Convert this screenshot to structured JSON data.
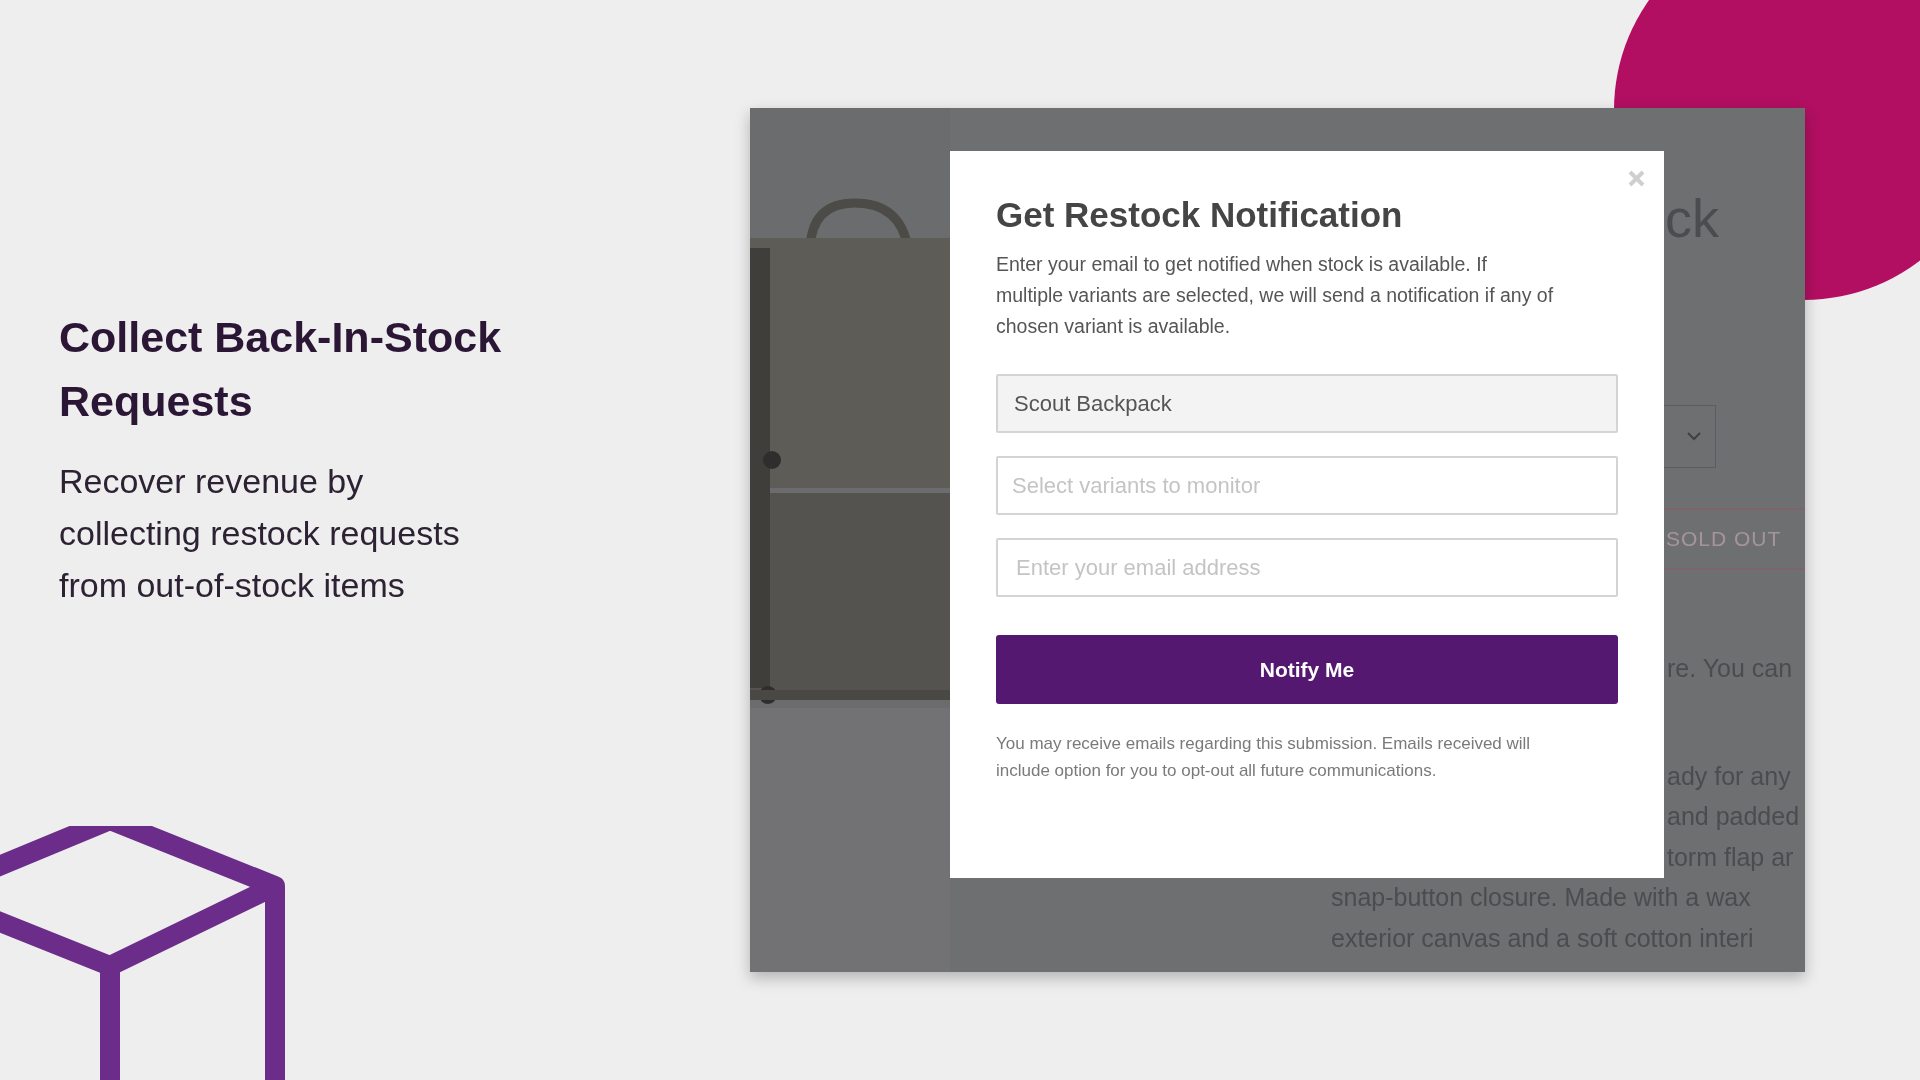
{
  "intro": {
    "heading": "Collect Back-In-Stock Requests",
    "description": "Recover revenue by collecting restock requests from out-of-stock items"
  },
  "store_page": {
    "title_fragment": "ck",
    "sold_out": "SOLD OUT",
    "description_lines": [
      {
        "text": "re. You can",
        "partial": true
      },
      {
        "text": "ady for any",
        "partial": true
      },
      {
        "text": "and padded",
        "partial": true
      },
      {
        "text": "torm flap ar",
        "partial": true
      },
      {
        "text": "snap-button closure. Made with a wax",
        "partial": false
      },
      {
        "text": "exterior canvas and a soft cotton interi",
        "partial": false
      }
    ]
  },
  "modal": {
    "title": "Get Restock Notification",
    "intro": "Enter your email to get notified when stock is available. If multiple variants are selected, we will send a notification if any of chosen variant is available.",
    "fields": [
      {
        "kind": "product",
        "value": "Scout Backpack",
        "disabled": true
      },
      {
        "kind": "select",
        "placeholder": "Select variants to monitor",
        "disabled": false
      },
      {
        "kind": "email",
        "placeholder": "Enter your email address",
        "disabled": false
      }
    ],
    "submit": "Notify Me",
    "disclaimer": "You may receive emails regarding this submission. Emails received will include option for you to opt-out all future communications."
  }
}
